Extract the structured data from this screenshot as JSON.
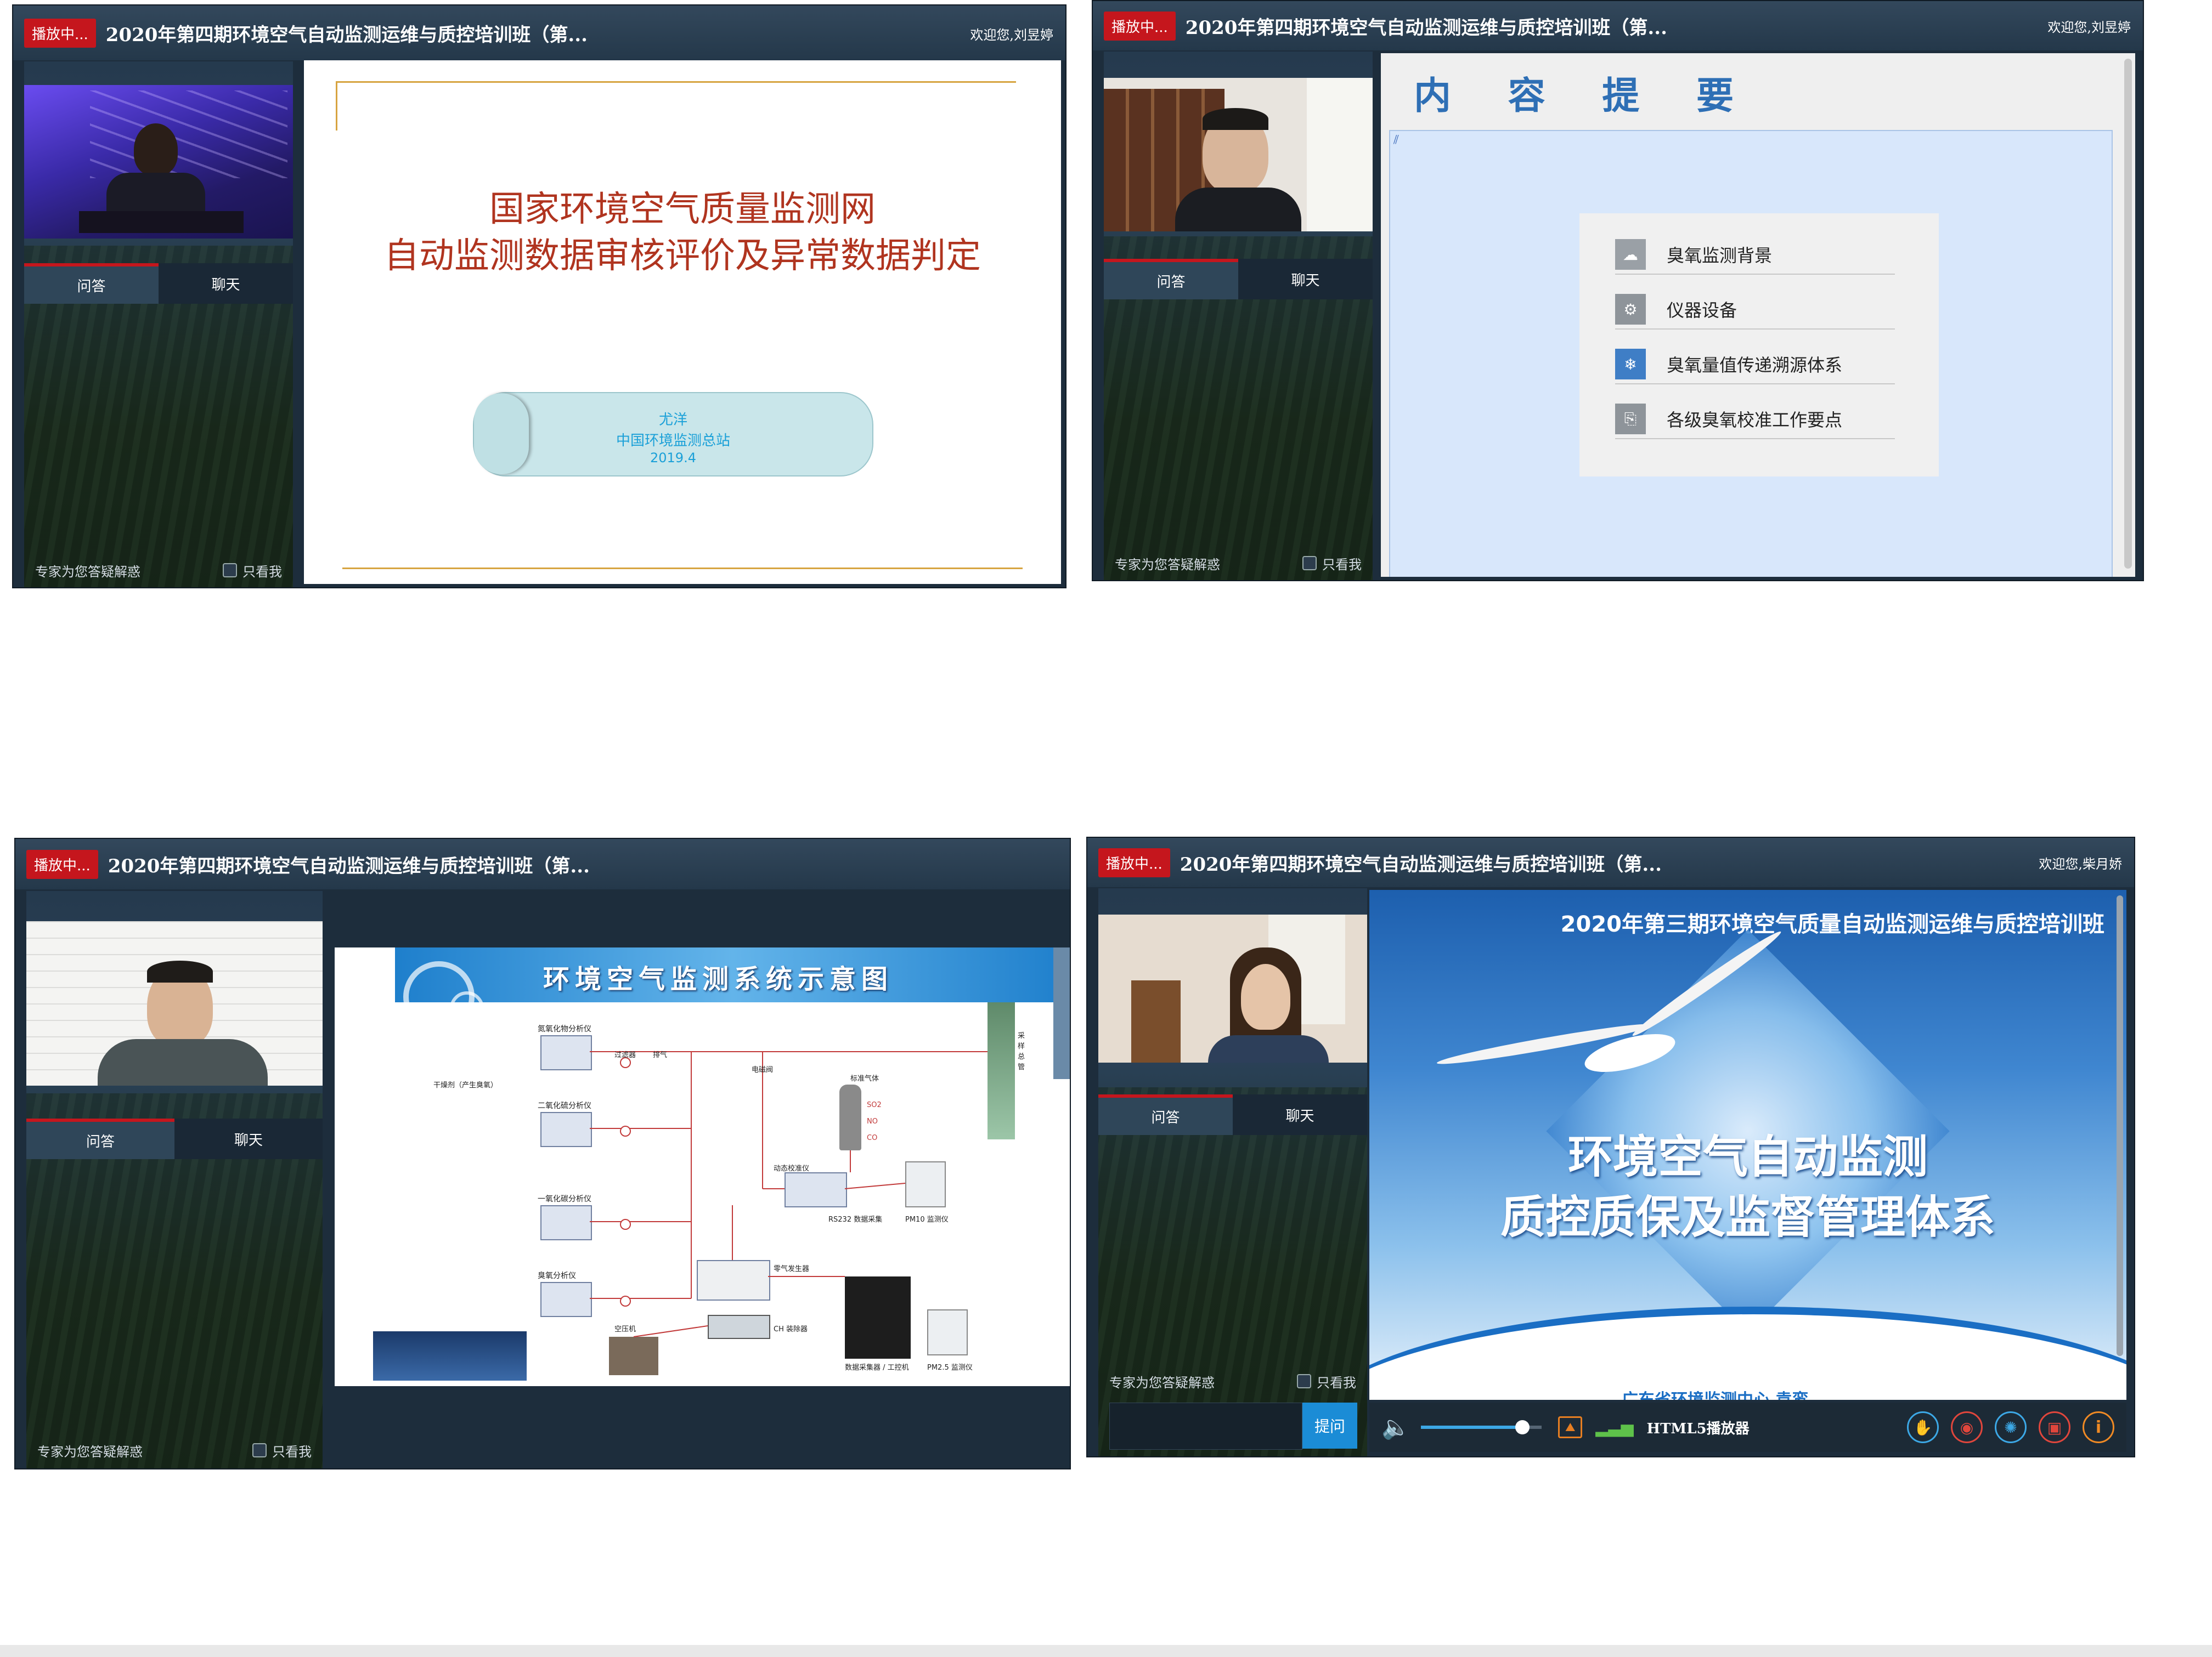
{
  "panels": [
    {
      "live_badge": "播放中...",
      "title": "2020年第四期环境空气自动监测运维与质控培训班（第...",
      "welcome": "欢迎您,刘昱婷",
      "tab_qa": "问答",
      "tab_chat": "聊天",
      "footer_hint": "专家为您答疑解惑",
      "only_me": "只看我",
      "slide": {
        "title_line1": "国家环境空气质量监测网",
        "title_line2": "自动监测数据审核评价及异常数据判定",
        "author": "尤洋",
        "org": "中国环境监测总站",
        "date": "2019.4"
      }
    },
    {
      "live_badge": "播放中...",
      "title": "2020年第四期环境空气自动监测运维与质控培训班（第...",
      "welcome": "欢迎您,刘昱婷",
      "tab_qa": "问答",
      "tab_chat": "聊天",
      "footer_hint": "专家为您答疑解惑",
      "only_me": "只看我",
      "slide": {
        "heading": "内 容 提 要",
        "items": [
          "臭氧监测背景",
          "仪器设备",
          "臭氧量值传递溯源体系",
          "各级臭氧校准工作要点"
        ]
      }
    },
    {
      "live_badge": "播放中...",
      "title": "2020年第四期环境空气自动监测运维与质控培训班（第...",
      "tab_qa": "问答",
      "tab_chat": "聊天",
      "footer_hint": "专家为您答疑解惑",
      "only_me": "只看我",
      "slide": {
        "heading": "环境空气监测系统示意图",
        "labels": [
          "氮氧化物分析仪",
          "二氧化硫分析仪",
          "一氧化碳分析仪",
          "臭氧分析仪",
          "过滤器",
          "排气",
          "电磁阀",
          "标准气体",
          "SO2",
          "NO",
          "CO",
          "动态校准仪",
          "RS232 数据采集",
          "PM10 监测仪",
          "零气发生器",
          "CH 装除器",
          "空压机",
          "数据采集器 / 工控机",
          "PM2.5 监测仪",
          "采样总管",
          "干燥剂（产生臭氧）"
        ]
      }
    },
    {
      "live_badge": "播放中...",
      "title": "2020年第四期环境空气自动监测运维与质控培训班（第...",
      "welcome": "欢迎您,柴月娇",
      "tab_qa": "问答",
      "tab_chat": "聊天",
      "footer_hint": "专家为您答疑解惑",
      "only_me": "只看我",
      "ask_button": "提问",
      "player_label": "HTML5播放器",
      "volume": 0.84,
      "slide": {
        "header": "2020年第三期环境空气质量自动监测运维与质控培训班",
        "title_line1": "环境空气自动监测",
        "title_line2": "质控质保及监督管理体系",
        "footer_partial": "广东省环境监测中心  袁鸾"
      }
    }
  ]
}
